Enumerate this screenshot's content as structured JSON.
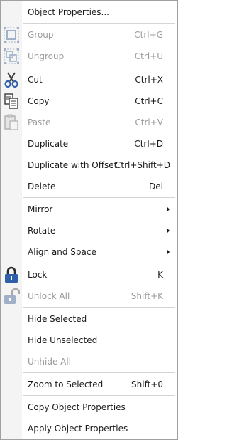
{
  "menu": {
    "object_properties": {
      "label": "Object Properties..."
    },
    "group": {
      "label": "Group",
      "shortcut": "Ctrl+G"
    },
    "ungroup": {
      "label": "Ungroup",
      "shortcut": "Ctrl+U"
    },
    "cut": {
      "label": "Cut",
      "shortcut": "Ctrl+X"
    },
    "copy": {
      "label": "Copy",
      "shortcut": "Ctrl+C"
    },
    "paste": {
      "label": "Paste",
      "shortcut": "Ctrl+V"
    },
    "duplicate": {
      "label": "Duplicate",
      "shortcut": "Ctrl+D"
    },
    "duplicate_offset": {
      "label": "Duplicate with Offset",
      "shortcut": "Ctrl+Shift+D"
    },
    "delete": {
      "label": "Delete",
      "shortcut": "Del"
    },
    "mirror": {
      "label": "Mirror"
    },
    "rotate": {
      "label": "Rotate"
    },
    "align_space": {
      "label": "Align and Space"
    },
    "lock": {
      "label": "Lock",
      "shortcut": "K"
    },
    "unlock_all": {
      "label": "Unlock All",
      "shortcut": "Shift+K"
    },
    "hide_selected": {
      "label": "Hide Selected"
    },
    "hide_unselected": {
      "label": "Hide Unselected"
    },
    "unhide_all": {
      "label": "Unhide All"
    },
    "zoom_selected": {
      "label": "Zoom to Selected",
      "shortcut": "Shift+0"
    },
    "copy_props": {
      "label": "Copy Object Properties"
    },
    "apply_props": {
      "label": "Apply Object Properties"
    }
  },
  "icons": {
    "group": "group-icon",
    "ungroup": "ungroup-icon",
    "cut": "scissors-icon",
    "copy": "copy-icon",
    "paste": "paste-icon",
    "lock": "lock-icon",
    "unlock": "unlock-icon"
  },
  "colors": {
    "text": "#1a1a1a",
    "disabled_text": "#9b9b9b",
    "separator": "#d4d4d4",
    "gutter": "#f4f4f4",
    "icon_blue": "#2f5fa8",
    "icon_disabled": "#9fb0c8"
  }
}
